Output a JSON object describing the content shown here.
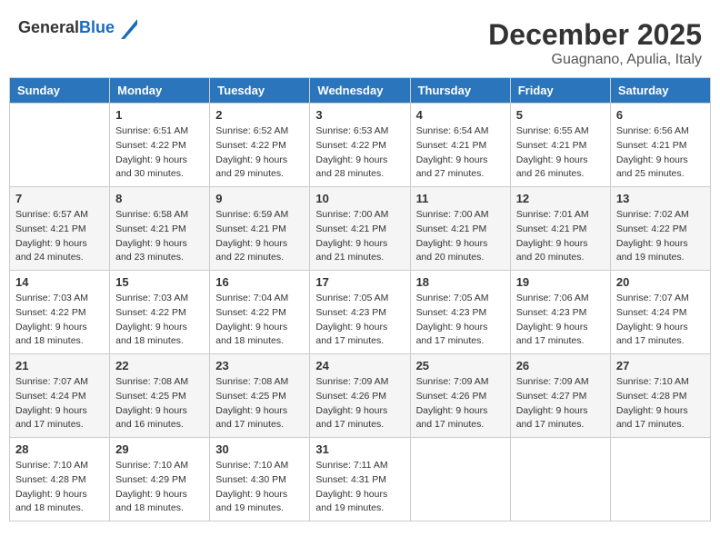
{
  "header": {
    "logo_general": "General",
    "logo_blue": "Blue",
    "title": "December 2025",
    "location": "Guagnano, Apulia, Italy"
  },
  "days_of_week": [
    "Sunday",
    "Monday",
    "Tuesday",
    "Wednesday",
    "Thursday",
    "Friday",
    "Saturday"
  ],
  "weeks": [
    [
      {
        "day": "",
        "sunrise": "",
        "sunset": "",
        "daylight": ""
      },
      {
        "day": "1",
        "sunrise": "Sunrise: 6:51 AM",
        "sunset": "Sunset: 4:22 PM",
        "daylight": "Daylight: 9 hours and 30 minutes."
      },
      {
        "day": "2",
        "sunrise": "Sunrise: 6:52 AM",
        "sunset": "Sunset: 4:22 PM",
        "daylight": "Daylight: 9 hours and 29 minutes."
      },
      {
        "day": "3",
        "sunrise": "Sunrise: 6:53 AM",
        "sunset": "Sunset: 4:22 PM",
        "daylight": "Daylight: 9 hours and 28 minutes."
      },
      {
        "day": "4",
        "sunrise": "Sunrise: 6:54 AM",
        "sunset": "Sunset: 4:21 PM",
        "daylight": "Daylight: 9 hours and 27 minutes."
      },
      {
        "day": "5",
        "sunrise": "Sunrise: 6:55 AM",
        "sunset": "Sunset: 4:21 PM",
        "daylight": "Daylight: 9 hours and 26 minutes."
      },
      {
        "day": "6",
        "sunrise": "Sunrise: 6:56 AM",
        "sunset": "Sunset: 4:21 PM",
        "daylight": "Daylight: 9 hours and 25 minutes."
      }
    ],
    [
      {
        "day": "7",
        "sunrise": "Sunrise: 6:57 AM",
        "sunset": "Sunset: 4:21 PM",
        "daylight": "Daylight: 9 hours and 24 minutes."
      },
      {
        "day": "8",
        "sunrise": "Sunrise: 6:58 AM",
        "sunset": "Sunset: 4:21 PM",
        "daylight": "Daylight: 9 hours and 23 minutes."
      },
      {
        "day": "9",
        "sunrise": "Sunrise: 6:59 AM",
        "sunset": "Sunset: 4:21 PM",
        "daylight": "Daylight: 9 hours and 22 minutes."
      },
      {
        "day": "10",
        "sunrise": "Sunrise: 7:00 AM",
        "sunset": "Sunset: 4:21 PM",
        "daylight": "Daylight: 9 hours and 21 minutes."
      },
      {
        "day": "11",
        "sunrise": "Sunrise: 7:00 AM",
        "sunset": "Sunset: 4:21 PM",
        "daylight": "Daylight: 9 hours and 20 minutes."
      },
      {
        "day": "12",
        "sunrise": "Sunrise: 7:01 AM",
        "sunset": "Sunset: 4:21 PM",
        "daylight": "Daylight: 9 hours and 20 minutes."
      },
      {
        "day": "13",
        "sunrise": "Sunrise: 7:02 AM",
        "sunset": "Sunset: 4:22 PM",
        "daylight": "Daylight: 9 hours and 19 minutes."
      }
    ],
    [
      {
        "day": "14",
        "sunrise": "Sunrise: 7:03 AM",
        "sunset": "Sunset: 4:22 PM",
        "daylight": "Daylight: 9 hours and 18 minutes."
      },
      {
        "day": "15",
        "sunrise": "Sunrise: 7:03 AM",
        "sunset": "Sunset: 4:22 PM",
        "daylight": "Daylight: 9 hours and 18 minutes."
      },
      {
        "day": "16",
        "sunrise": "Sunrise: 7:04 AM",
        "sunset": "Sunset: 4:22 PM",
        "daylight": "Daylight: 9 hours and 18 minutes."
      },
      {
        "day": "17",
        "sunrise": "Sunrise: 7:05 AM",
        "sunset": "Sunset: 4:23 PM",
        "daylight": "Daylight: 9 hours and 17 minutes."
      },
      {
        "day": "18",
        "sunrise": "Sunrise: 7:05 AM",
        "sunset": "Sunset: 4:23 PM",
        "daylight": "Daylight: 9 hours and 17 minutes."
      },
      {
        "day": "19",
        "sunrise": "Sunrise: 7:06 AM",
        "sunset": "Sunset: 4:23 PM",
        "daylight": "Daylight: 9 hours and 17 minutes."
      },
      {
        "day": "20",
        "sunrise": "Sunrise: 7:07 AM",
        "sunset": "Sunset: 4:24 PM",
        "daylight": "Daylight: 9 hours and 17 minutes."
      }
    ],
    [
      {
        "day": "21",
        "sunrise": "Sunrise: 7:07 AM",
        "sunset": "Sunset: 4:24 PM",
        "daylight": "Daylight: 9 hours and 17 minutes."
      },
      {
        "day": "22",
        "sunrise": "Sunrise: 7:08 AM",
        "sunset": "Sunset: 4:25 PM",
        "daylight": "Daylight: 9 hours and 16 minutes."
      },
      {
        "day": "23",
        "sunrise": "Sunrise: 7:08 AM",
        "sunset": "Sunset: 4:25 PM",
        "daylight": "Daylight: 9 hours and 17 minutes."
      },
      {
        "day": "24",
        "sunrise": "Sunrise: 7:09 AM",
        "sunset": "Sunset: 4:26 PM",
        "daylight": "Daylight: 9 hours and 17 minutes."
      },
      {
        "day": "25",
        "sunrise": "Sunrise: 7:09 AM",
        "sunset": "Sunset: 4:26 PM",
        "daylight": "Daylight: 9 hours and 17 minutes."
      },
      {
        "day": "26",
        "sunrise": "Sunrise: 7:09 AM",
        "sunset": "Sunset: 4:27 PM",
        "daylight": "Daylight: 9 hours and 17 minutes."
      },
      {
        "day": "27",
        "sunrise": "Sunrise: 7:10 AM",
        "sunset": "Sunset: 4:28 PM",
        "daylight": "Daylight: 9 hours and 17 minutes."
      }
    ],
    [
      {
        "day": "28",
        "sunrise": "Sunrise: 7:10 AM",
        "sunset": "Sunset: 4:28 PM",
        "daylight": "Daylight: 9 hours and 18 minutes."
      },
      {
        "day": "29",
        "sunrise": "Sunrise: 7:10 AM",
        "sunset": "Sunset: 4:29 PM",
        "daylight": "Daylight: 9 hours and 18 minutes."
      },
      {
        "day": "30",
        "sunrise": "Sunrise: 7:10 AM",
        "sunset": "Sunset: 4:30 PM",
        "daylight": "Daylight: 9 hours and 19 minutes."
      },
      {
        "day": "31",
        "sunrise": "Sunrise: 7:11 AM",
        "sunset": "Sunset: 4:31 PM",
        "daylight": "Daylight: 9 hours and 19 minutes."
      },
      {
        "day": "",
        "sunrise": "",
        "sunset": "",
        "daylight": ""
      },
      {
        "day": "",
        "sunrise": "",
        "sunset": "",
        "daylight": ""
      },
      {
        "day": "",
        "sunrise": "",
        "sunset": "",
        "daylight": ""
      }
    ]
  ]
}
